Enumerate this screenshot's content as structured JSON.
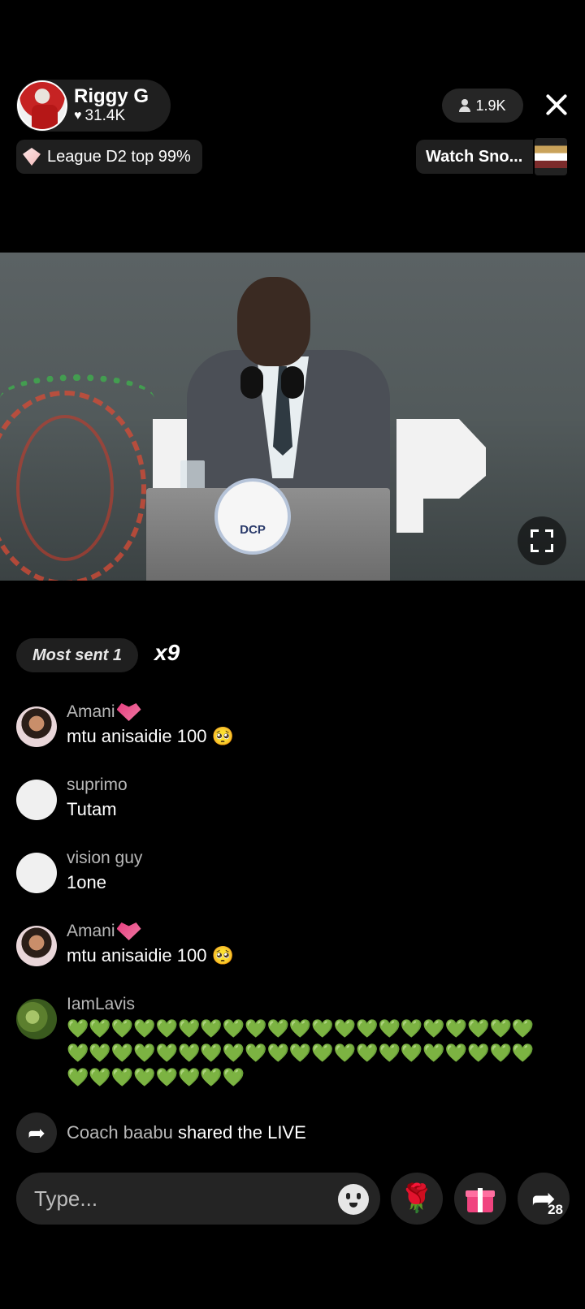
{
  "header": {
    "host_name": "Riggy G",
    "host_likes": "31.4K",
    "viewer_count": "1.9K",
    "league_badge": "League D2 top 99%",
    "watch_label": "Watch Sno..."
  },
  "video": {
    "podium_seal_text": "DCP"
  },
  "gifts": {
    "most_sent_label": "Most sent 1",
    "multiplier": "x9"
  },
  "comments": [
    {
      "user": "Amani",
      "text": "mtu anisaidie 100 🥺",
      "avatar": "photo-girl",
      "badge": "heart-ribbon-icon"
    },
    {
      "user": "suprimo",
      "text": "Tutam",
      "avatar": "blank"
    },
    {
      "user": "vision guy",
      "text": "1one",
      "avatar": "blank"
    },
    {
      "user": "Amani",
      "text": "mtu anisaidie 100 🥺",
      "avatar": "photo-girl",
      "badge": "heart-ribbon-icon"
    },
    {
      "user": "IamLavis",
      "text": "💚💚💚💚💚💚💚💚💚💚💚💚💚💚💚💚💚💚💚💚💚💚💚💚💚💚💚💚💚💚💚💚💚💚💚💚💚💚💚💚💚💚💚💚💚💚💚💚💚💚",
      "avatar": "photo-green"
    }
  ],
  "share_event": {
    "user": "Coach baabu",
    "text": " shared the LIVE"
  },
  "bottom_bar": {
    "input_placeholder": "Type...",
    "rose_icon": "🌹",
    "share_count": "28"
  },
  "colors": {
    "background": "#000000",
    "pill": "rgba(255,255,255,0.12)",
    "username_grey": "#b8b8b8",
    "gift_pink": "#f0447f"
  }
}
